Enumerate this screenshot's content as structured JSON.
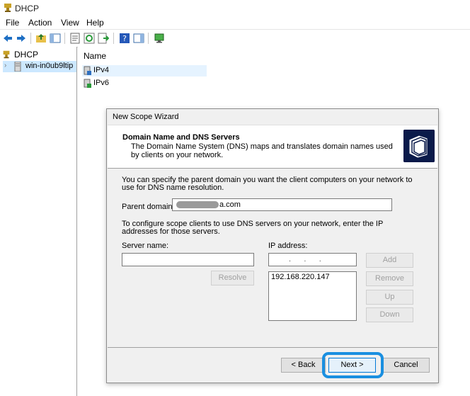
{
  "window": {
    "title": "DHCP"
  },
  "menu": [
    "File",
    "Action",
    "View",
    "Help"
  ],
  "tree": {
    "root": "DHCP",
    "server": "win-in0ub9ltip"
  },
  "list": {
    "column": "Name",
    "rows": [
      "IPv4",
      "IPv6"
    ]
  },
  "wizard": {
    "title": "New Scope Wizard",
    "header_title": "Domain Name and DNS Servers",
    "header_desc": "The Domain Name System (DNS) maps and translates domain names used by clients on your network.",
    "parent_intro": "You can specify the parent domain you want the client computers on your network to use for DNS name resolution.",
    "parent_label": "Parent domain:",
    "parent_value": "a.com",
    "dns_intro": "To configure scope clients to use DNS servers on your network, enter the IP addresses for those servers.",
    "server_label": "Server name:",
    "ip_label": "IP address:",
    "ip_placeholder": ".      .      .",
    "resolve": "Resolve",
    "add": "Add",
    "remove": "Remove",
    "up": "Up",
    "down": "Down",
    "ip_list": [
      "192.168.220.147"
    ],
    "back": "< Back",
    "next": "Next >",
    "cancel": "Cancel"
  },
  "colors": {
    "accent": "#1a8fe0",
    "selection": "#cce8ff"
  }
}
